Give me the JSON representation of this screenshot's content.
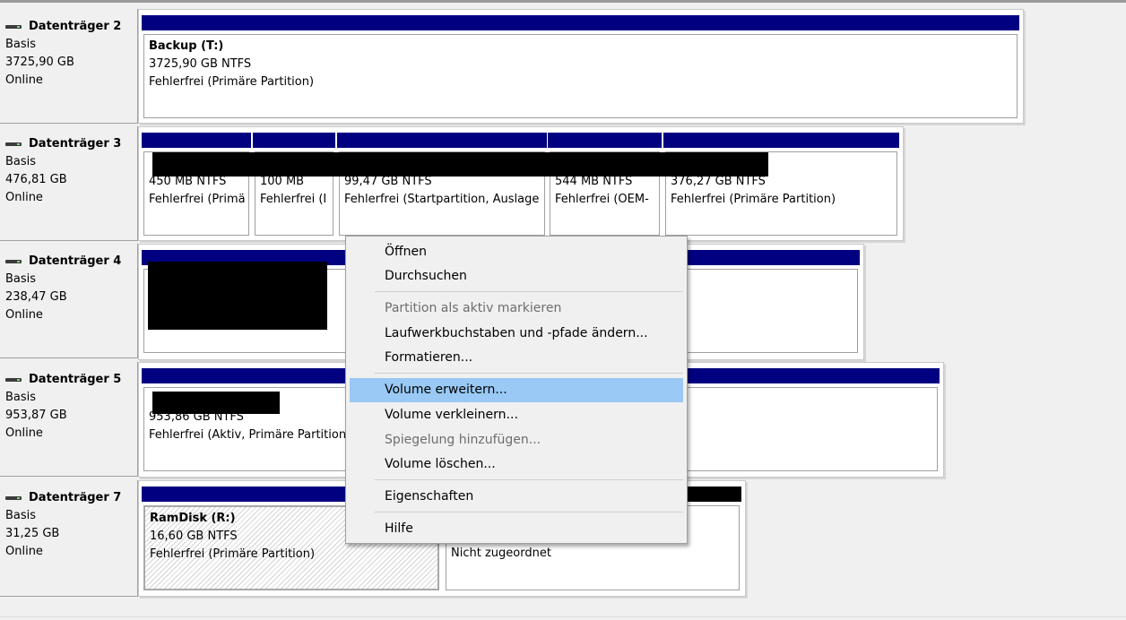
{
  "disks": [
    {
      "name": "Datenträger 2",
      "type": "Basis",
      "size": "3725,90 GB",
      "status": "Online"
    },
    {
      "name": "Datenträger 3",
      "type": "Basis",
      "size": "476,81 GB",
      "status": "Online"
    },
    {
      "name": "Datenträger 4",
      "type": "Basis",
      "size": "238,47 GB",
      "status": "Online"
    },
    {
      "name": "Datenträger 5",
      "type": "Basis",
      "size": "953,87 GB",
      "status": "Online"
    },
    {
      "name": "Datenträger 7",
      "type": "Basis",
      "size": "31,25 GB",
      "status": "Online"
    }
  ],
  "disk2_vol": {
    "title": "Backup  (T:)",
    "size": "3725,90 GB NTFS",
    "status": "Fehlerfrei (Primäre Partition)"
  },
  "disk3_vols": [
    {
      "size": "450 MB NTFS",
      "status": "Fehlerfrei (Primä"
    },
    {
      "size": "100 MB",
      "status": "Fehlerfrei (I"
    },
    {
      "size": "99,47 GB NTFS",
      "status": "Fehlerfrei (Startpartition, Auslage"
    },
    {
      "size": "544 MB NTFS",
      "status": "Fehlerfrei (OEM-"
    },
    {
      "size": "376,27 GB NTFS",
      "status": "Fehlerfrei (Primäre Partition)"
    }
  ],
  "disk5_vol": {
    "size": "953,86 GB NTFS",
    "status": "Fehlerfrei (Aktiv, Primäre Partition"
  },
  "disk7_vols": [
    {
      "title": "RamDisk  (R:)",
      "size": "16,60 GB NTFS",
      "status": "Fehlerfrei (Primäre Partition)"
    },
    {
      "status": "Nicht zugeordnet"
    }
  ],
  "context_menu": {
    "items": [
      {
        "label": "Öffnen",
        "enabled": true
      },
      {
        "label": "Durchsuchen",
        "enabled": true
      },
      {
        "label": "Partition als aktiv markieren",
        "enabled": false
      },
      {
        "label": "Laufwerkbuchstaben und -pfade ändern...",
        "enabled": true
      },
      {
        "label": "Formatieren...",
        "enabled": true
      },
      {
        "label": "Volume erweitern...",
        "enabled": true,
        "highlighted": true
      },
      {
        "label": "Volume verkleinern...",
        "enabled": true
      },
      {
        "label": "Spiegelung hinzufügen...",
        "enabled": false
      },
      {
        "label": "Volume löschen...",
        "enabled": true
      },
      {
        "label": "Eigenschaften",
        "enabled": true
      },
      {
        "label": "Hilfe",
        "enabled": true
      }
    ]
  },
  "colors": {
    "volume_header": "#000080",
    "highlight": "#99c9f4",
    "background": "#f0f0f0"
  }
}
